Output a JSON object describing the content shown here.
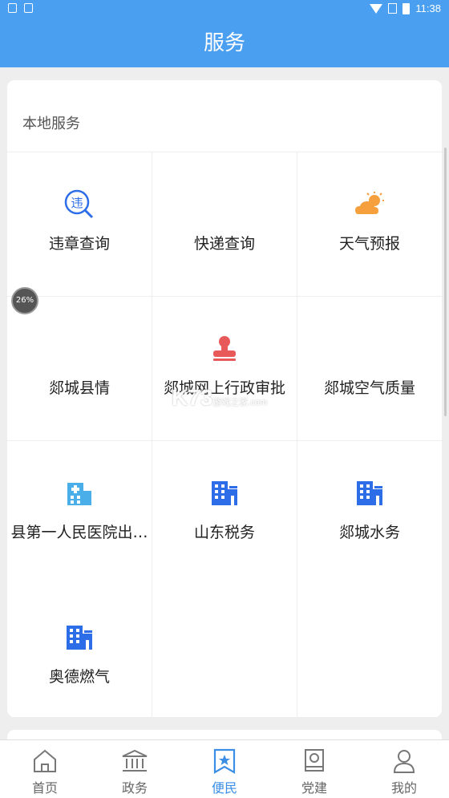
{
  "status_bar": {
    "time": "11:38"
  },
  "header": {
    "title": "服务"
  },
  "local_services": {
    "title": "本地服务",
    "items": [
      {
        "label": "违章查询",
        "icon": "violation-search-icon"
      },
      {
        "label": "快递查询",
        "icon": "express-icon"
      },
      {
        "label": "天气预报",
        "icon": "weather-icon"
      },
      {
        "label": "郯城县情",
        "icon": "county-info-icon"
      },
      {
        "label": "郯城网上行政审批",
        "icon": "stamp-icon"
      },
      {
        "label": "郯城空气质量",
        "icon": "air-quality-icon"
      },
      {
        "label": "县第一人民医院出…",
        "icon": "hospital-icon"
      },
      {
        "label": "山东税务",
        "icon": "building-icon"
      },
      {
        "label": "郯城水务",
        "icon": "building-icon"
      },
      {
        "label": "奥德燃气",
        "icon": "building-icon"
      }
    ]
  },
  "overlay": {
    "progress": "26%"
  },
  "watermark": {
    "text": "K73",
    "sub": "游戏之家",
    "domain": ".com"
  },
  "tabbar": {
    "items": [
      {
        "label": "首页",
        "icon": "home-icon",
        "active": false
      },
      {
        "label": "政务",
        "icon": "government-icon",
        "active": false
      },
      {
        "label": "便民",
        "icon": "bookmark-star-icon",
        "active": true
      },
      {
        "label": "党建",
        "icon": "party-book-icon",
        "active": false
      },
      {
        "label": "我的",
        "icon": "user-icon",
        "active": false
      }
    ]
  },
  "colors": {
    "primary": "#4a9ff0",
    "tab_active": "#3a8ee6",
    "icon_blue": "#2d6ee8",
    "icon_red": "#e85a5a",
    "icon_orange": "#f5a03c"
  }
}
